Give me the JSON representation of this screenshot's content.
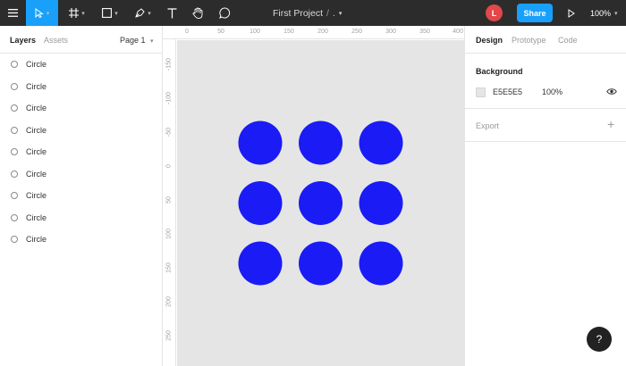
{
  "toolbar": {
    "project_title": "First Project",
    "title_separator": "/",
    "title_dot": ".",
    "avatar_initial": "L",
    "share_label": "Share",
    "zoom": "100%"
  },
  "left_panel": {
    "tabs": [
      {
        "label": "Layers",
        "active": true
      },
      {
        "label": "Assets",
        "active": false
      }
    ],
    "page_selector": "Page 1",
    "layers": [
      {
        "name": "Circle"
      },
      {
        "name": "Circle"
      },
      {
        "name": "Circle"
      },
      {
        "name": "Circle"
      },
      {
        "name": "Circle"
      },
      {
        "name": "Circle"
      },
      {
        "name": "Circle"
      },
      {
        "name": "Circle"
      },
      {
        "name": "Circle"
      }
    ]
  },
  "rulers": {
    "top_labels": [
      "0",
      "50",
      "100",
      "150",
      "200",
      "250",
      "300",
      "350",
      "400"
    ],
    "left_labels": [
      "-150",
      "-100",
      "-50",
      "0",
      "50",
      "100",
      "150",
      "200",
      "250"
    ]
  },
  "canvas": {
    "background_color": "#e5e5e5",
    "circle_color": "#1b1bf5",
    "circle_count": 9
  },
  "right_panel": {
    "tabs": [
      {
        "label": "Design",
        "active": true
      },
      {
        "label": "Prototype",
        "active": false
      },
      {
        "label": "Code",
        "active": false
      }
    ],
    "background_section": {
      "title": "Background",
      "hex": "E5E5E5",
      "opacity": "100%"
    },
    "export_section": {
      "title": "Export"
    }
  },
  "help_label": "?"
}
